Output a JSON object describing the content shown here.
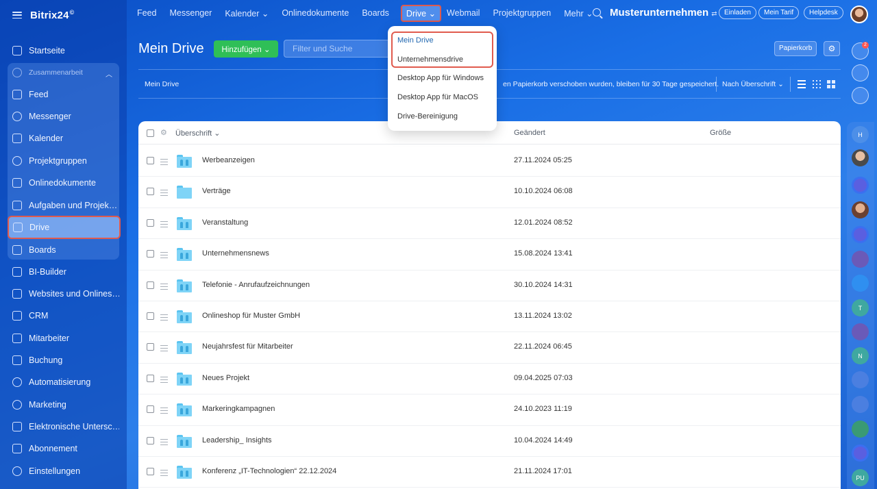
{
  "brand": {
    "name": "Bitrix24",
    "sup": "©"
  },
  "sidebar": {
    "items": [
      {
        "label": "Startseite",
        "icon": "home-icon"
      },
      {
        "label": "Zusammenarbeit",
        "icon": "collaboration-icon"
      },
      {
        "label": "Feed",
        "icon": "feed-icon"
      },
      {
        "label": "Messenger",
        "icon": "messenger-icon"
      },
      {
        "label": "Kalender",
        "icon": "calendar-icon"
      },
      {
        "label": "Projektgruppen",
        "icon": "groups-icon"
      },
      {
        "label": "Onlinedokumente",
        "icon": "document-icon"
      },
      {
        "label": "Aufgaben und Projek…",
        "icon": "tasks-icon"
      },
      {
        "label": "Drive",
        "icon": "drive-icon"
      },
      {
        "label": "Boards",
        "icon": "boards-icon"
      },
      {
        "label": "BI-Builder",
        "icon": "bi-builder-icon"
      },
      {
        "label": "Websites und Onlines…",
        "icon": "cart-icon"
      },
      {
        "label": "CRM",
        "icon": "crm-icon"
      },
      {
        "label": "Mitarbeiter",
        "icon": "employees-icon"
      },
      {
        "label": "Buchung",
        "icon": "booking-icon"
      },
      {
        "label": "Automatisierung",
        "icon": "automation-icon"
      },
      {
        "label": "Marketing",
        "icon": "marketing-icon"
      },
      {
        "label": "Elektronische Untersc…",
        "icon": "signature-icon"
      },
      {
        "label": "Abonnement",
        "icon": "subscription-icon"
      },
      {
        "label": "Einstellungen",
        "icon": "settings-icon"
      }
    ]
  },
  "topnav": {
    "items": [
      "Feed",
      "Messenger",
      "Kalender ⌄",
      "Onlinedokumente",
      "Boards",
      "Drive ⌄",
      "Webmail",
      "Projektgruppen",
      "Mehr ⌄"
    ],
    "company": "Musterunternehmen",
    "company_swap": "⇄",
    "invite": "Einladen",
    "tariff": "Mein Tarif",
    "helpdesk": "Helpdesk"
  },
  "page": {
    "title": "Mein Drive",
    "add_label": "Hinzufügen ⌄",
    "filter_placeholder": "Filter und Suche",
    "trash": "Papierkorb",
    "breadcrumb": "Mein Drive",
    "info": "en Papierkorb verschoben wurden, bleiben für 30 Tage gespeichert.",
    "sort": "Nach Überschrift ⌄"
  },
  "dropdown": {
    "items": [
      "Mein Drive",
      "Unternehmensdrive",
      "Desktop App für Windows",
      "Desktop App für MacOS",
      "Drive-Bereinigung"
    ]
  },
  "table": {
    "columns": [
      "Überschrift ⌄",
      "Geändert",
      "Größe"
    ],
    "rows": [
      {
        "name": "Werbeanzeigen",
        "date": "27.11.2024 05:25"
      },
      {
        "name": "Verträge",
        "date": "10.10.2024 06:08"
      },
      {
        "name": "Veranstaltung",
        "date": "12.01.2024 08:52"
      },
      {
        "name": "Unternehmensnews",
        "date": "15.08.2024 13:41"
      },
      {
        "name": "Telefonie - Anrufaufzeichnungen",
        "date": "30.10.2024 14:31"
      },
      {
        "name": "Onlineshop für Muster GmbH",
        "date": "13.11.2024 13:02"
      },
      {
        "name": "Neujahrsfest für Mitarbeiter",
        "date": "22.11.2024 06:45"
      },
      {
        "name": "Neues Projekt",
        "date": "09.04.2025 07:03"
      },
      {
        "name": "Markeringkampagnen",
        "date": "24.10.2023 11:19"
      },
      {
        "name": "Leadership_ Insights",
        "date": "10.04.2024 14:49"
      },
      {
        "name": "Konferenz „IT-Technologien“ 22.12.2024",
        "date": "21.11.2024 17:01"
      }
    ]
  },
  "rail": {
    "notification_count": "2",
    "letters": [
      "H",
      "T",
      "N",
      "PU"
    ]
  },
  "colors": {
    "accent_green": "#2fbf57",
    "highlight_red": "#e05a4d",
    "link_blue": "#2067b0"
  }
}
